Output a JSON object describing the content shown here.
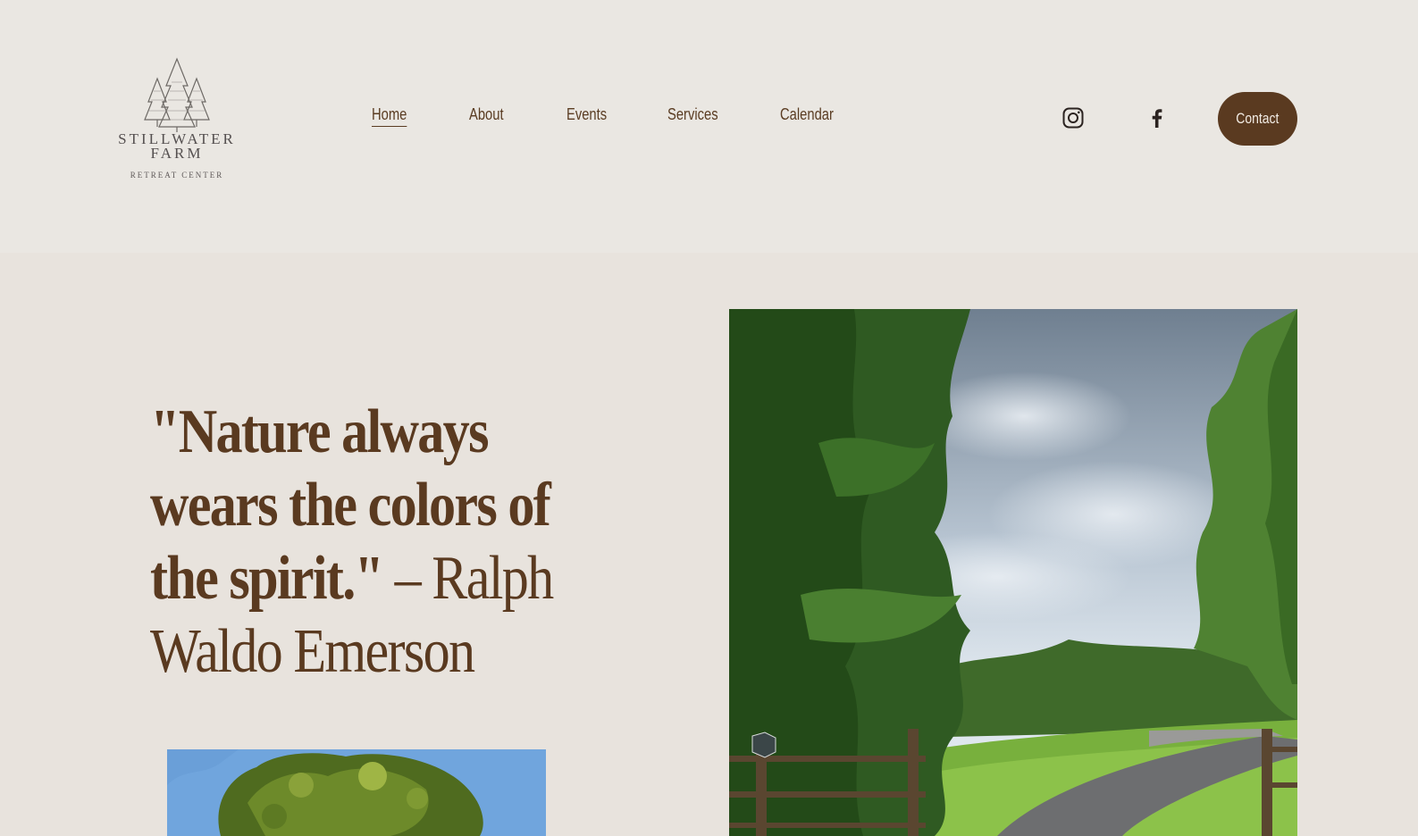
{
  "brand": {
    "name_line1": "STILLWATER",
    "name_line2": "FARM",
    "tagline": "RETREAT CENTER"
  },
  "nav": {
    "items": [
      {
        "label": "Home",
        "active": true
      },
      {
        "label": "About",
        "active": false
      },
      {
        "label": "Events",
        "active": false
      },
      {
        "label": "Services",
        "active": false
      },
      {
        "label": "Calendar",
        "active": false
      }
    ]
  },
  "social": {
    "instagram_icon": "instagram-icon",
    "facebook_icon": "facebook-icon"
  },
  "contact": {
    "label": "Contact"
  },
  "hero": {
    "quote": "\"Nature always wears the colors of the spirit.\"",
    "author": " – Ralph Waldo Emerson"
  },
  "colors": {
    "header_bg": "#eae7e2",
    "page_bg": "#e8e3dd",
    "brand_brown": "#5a3a20"
  }
}
